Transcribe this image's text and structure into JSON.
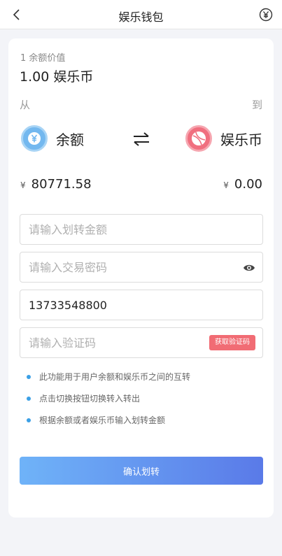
{
  "header": {
    "title": "娱乐钱包",
    "back_icon": "back-chevron-icon",
    "right_icon": "yen-circle-icon"
  },
  "rate": {
    "small": "1 余额价值",
    "big": "1.00 娱乐币"
  },
  "transfer": {
    "from_label": "从",
    "to_label": "到",
    "from_wallet": {
      "name": "余额",
      "icon": "yen-coin-icon",
      "color": "#73b8ef"
    },
    "to_wallet": {
      "name": "娱乐币",
      "icon": "ball-icon",
      "color": "#f06f7f"
    },
    "swap_icon": "swap-arrows-icon",
    "currency_symbol": "¥",
    "from_amount": "80771.58",
    "to_amount": "0.00"
  },
  "form": {
    "amount_placeholder": "请输入划转金额",
    "password_placeholder": "请输入交易密码",
    "phone_value": "13733548800",
    "code_placeholder": "请输入验证码",
    "code_button": "获取验证码"
  },
  "tips": [
    "此功能用于用户余额和娱乐币之间的互转",
    "点击切换按钮切换转入转出",
    "根据余额或者娱乐币输入划转金额"
  ],
  "submit_label": "确认划转",
  "colors": {
    "accent_blue": "#3ba0e6",
    "button_gradient_start": "#6fb3f8",
    "button_gradient_end": "#5a7ae8",
    "code_button": "#f16c74"
  }
}
